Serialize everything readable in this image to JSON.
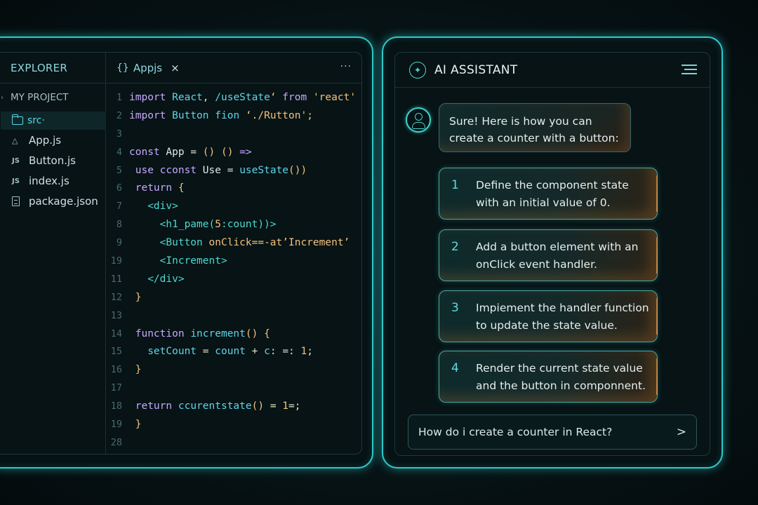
{
  "colors": {
    "accent": "#2fc9c9",
    "background": "#071416",
    "keyword": "#c7a8ff",
    "function": "#60d4e8",
    "string": "#f2c27d",
    "highlight_orange": "#d98a3c"
  },
  "explorer": {
    "title": "EXPLORER",
    "project": "MY PROJECT",
    "folder": "src·",
    "files": [
      {
        "icon": "react-file-icon",
        "badge": "△",
        "name": "App.js"
      },
      {
        "icon": "js-file-icon",
        "badge": "JS",
        "name": "Button.js"
      },
      {
        "icon": "js-file-icon",
        "badge": "JS",
        "name": "index.js"
      },
      {
        "icon": "json-file-icon",
        "badge": "",
        "name": "package.json"
      }
    ]
  },
  "editor": {
    "tab_label": "Appjs",
    "tab_close": "×",
    "more": "···",
    "line_numbers": [
      "1",
      "2",
      "3",
      "4",
      "5",
      "6",
      "7",
      "8",
      "9",
      "19",
      "11",
      "12",
      "13",
      "14",
      "15",
      "16",
      "17",
      "18",
      "19",
      "28"
    ]
  },
  "assistant": {
    "title": "AI ASSISTANT",
    "message": "Sure! Here is how you can create a counter with a button:",
    "steps": [
      {
        "num": "1",
        "text": "Define the component state with an initial value of 0."
      },
      {
        "num": "2",
        "text": "Add a button element with an onClick event handler."
      },
      {
        "num": "3",
        "text": "Impiement the handler function to update the state value."
      },
      {
        "num": "4",
        "text": "Render the current state value and the button in componnent."
      }
    ],
    "prompt": "How do i create a counter in React?",
    "send_glyph": ">"
  }
}
